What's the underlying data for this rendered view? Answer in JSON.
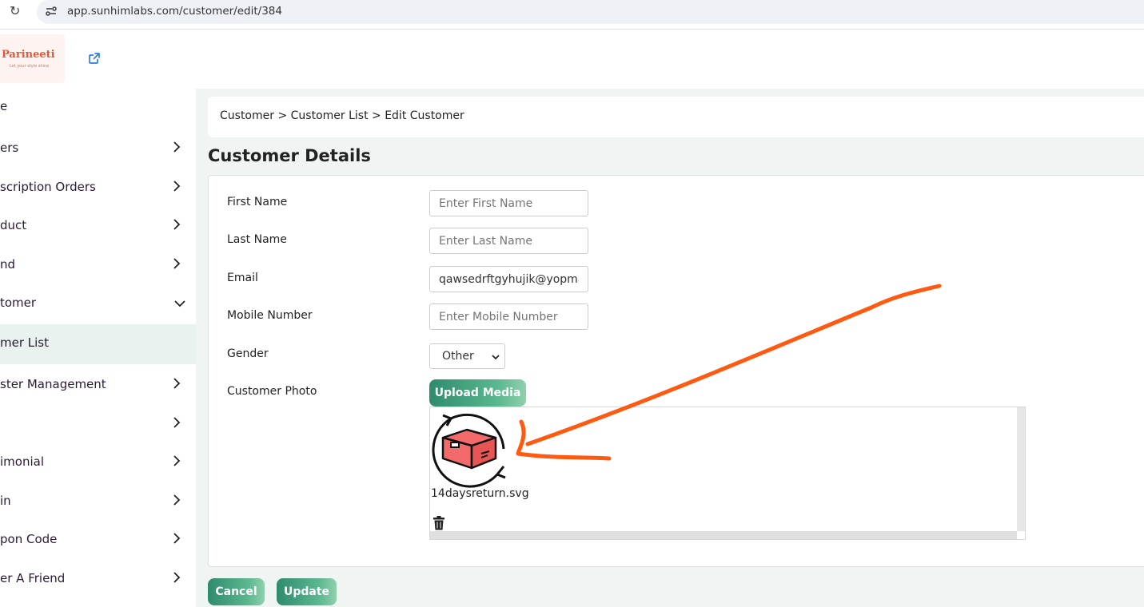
{
  "browser": {
    "url": "app.sunhimlabs.com/customer/edit/384"
  },
  "brand": {
    "name": "Parineeti",
    "tagline": "Let your style shine"
  },
  "sidebar": {
    "items": [
      {
        "label": "e",
        "has_chevron": false
      },
      {
        "label": "ers",
        "has_chevron": true
      },
      {
        "label": "scription Orders",
        "has_chevron": true
      },
      {
        "label": "duct",
        "has_chevron": true
      },
      {
        "label": "nd",
        "has_chevron": true
      },
      {
        "label": "tomer",
        "has_chevron": true,
        "expanded": true
      },
      {
        "label": "mer List",
        "has_chevron": false,
        "active": true
      },
      {
        "label": "ster Management",
        "has_chevron": true
      },
      {
        "label": "",
        "has_chevron": true
      },
      {
        "label": "imonial",
        "has_chevron": true
      },
      {
        "label": "in",
        "has_chevron": true
      },
      {
        "label": "pon Code",
        "has_chevron": true
      },
      {
        "label": "er A Friend",
        "has_chevron": true
      }
    ]
  },
  "breadcrumb": {
    "text": "Customer > Customer List > Edit Customer"
  },
  "page": {
    "title": "Customer Details"
  },
  "form": {
    "first_name": {
      "label": "First Name",
      "value": "",
      "placeholder": "Enter First Name"
    },
    "last_name": {
      "label": "Last Name",
      "value": "",
      "placeholder": "Enter Last Name"
    },
    "email": {
      "label": "Email",
      "value": "qawsedrftgyhujik@yopmail.com",
      "placeholder": ""
    },
    "mobile": {
      "label": "Mobile Number",
      "value": "",
      "placeholder": "Enter Mobile Number"
    },
    "gender": {
      "label": "Gender",
      "selected": "Other"
    },
    "photo": {
      "label": "Customer Photo",
      "upload_label": "Upload Media",
      "file_name": "14daysreturn.svg"
    }
  },
  "actions": {
    "cancel_label": "Cancel",
    "update_label": "Update"
  },
  "colors": {
    "accent": "#2e8b6e",
    "annotation": "#ff5a12",
    "box_icon": "#f26a6a"
  }
}
